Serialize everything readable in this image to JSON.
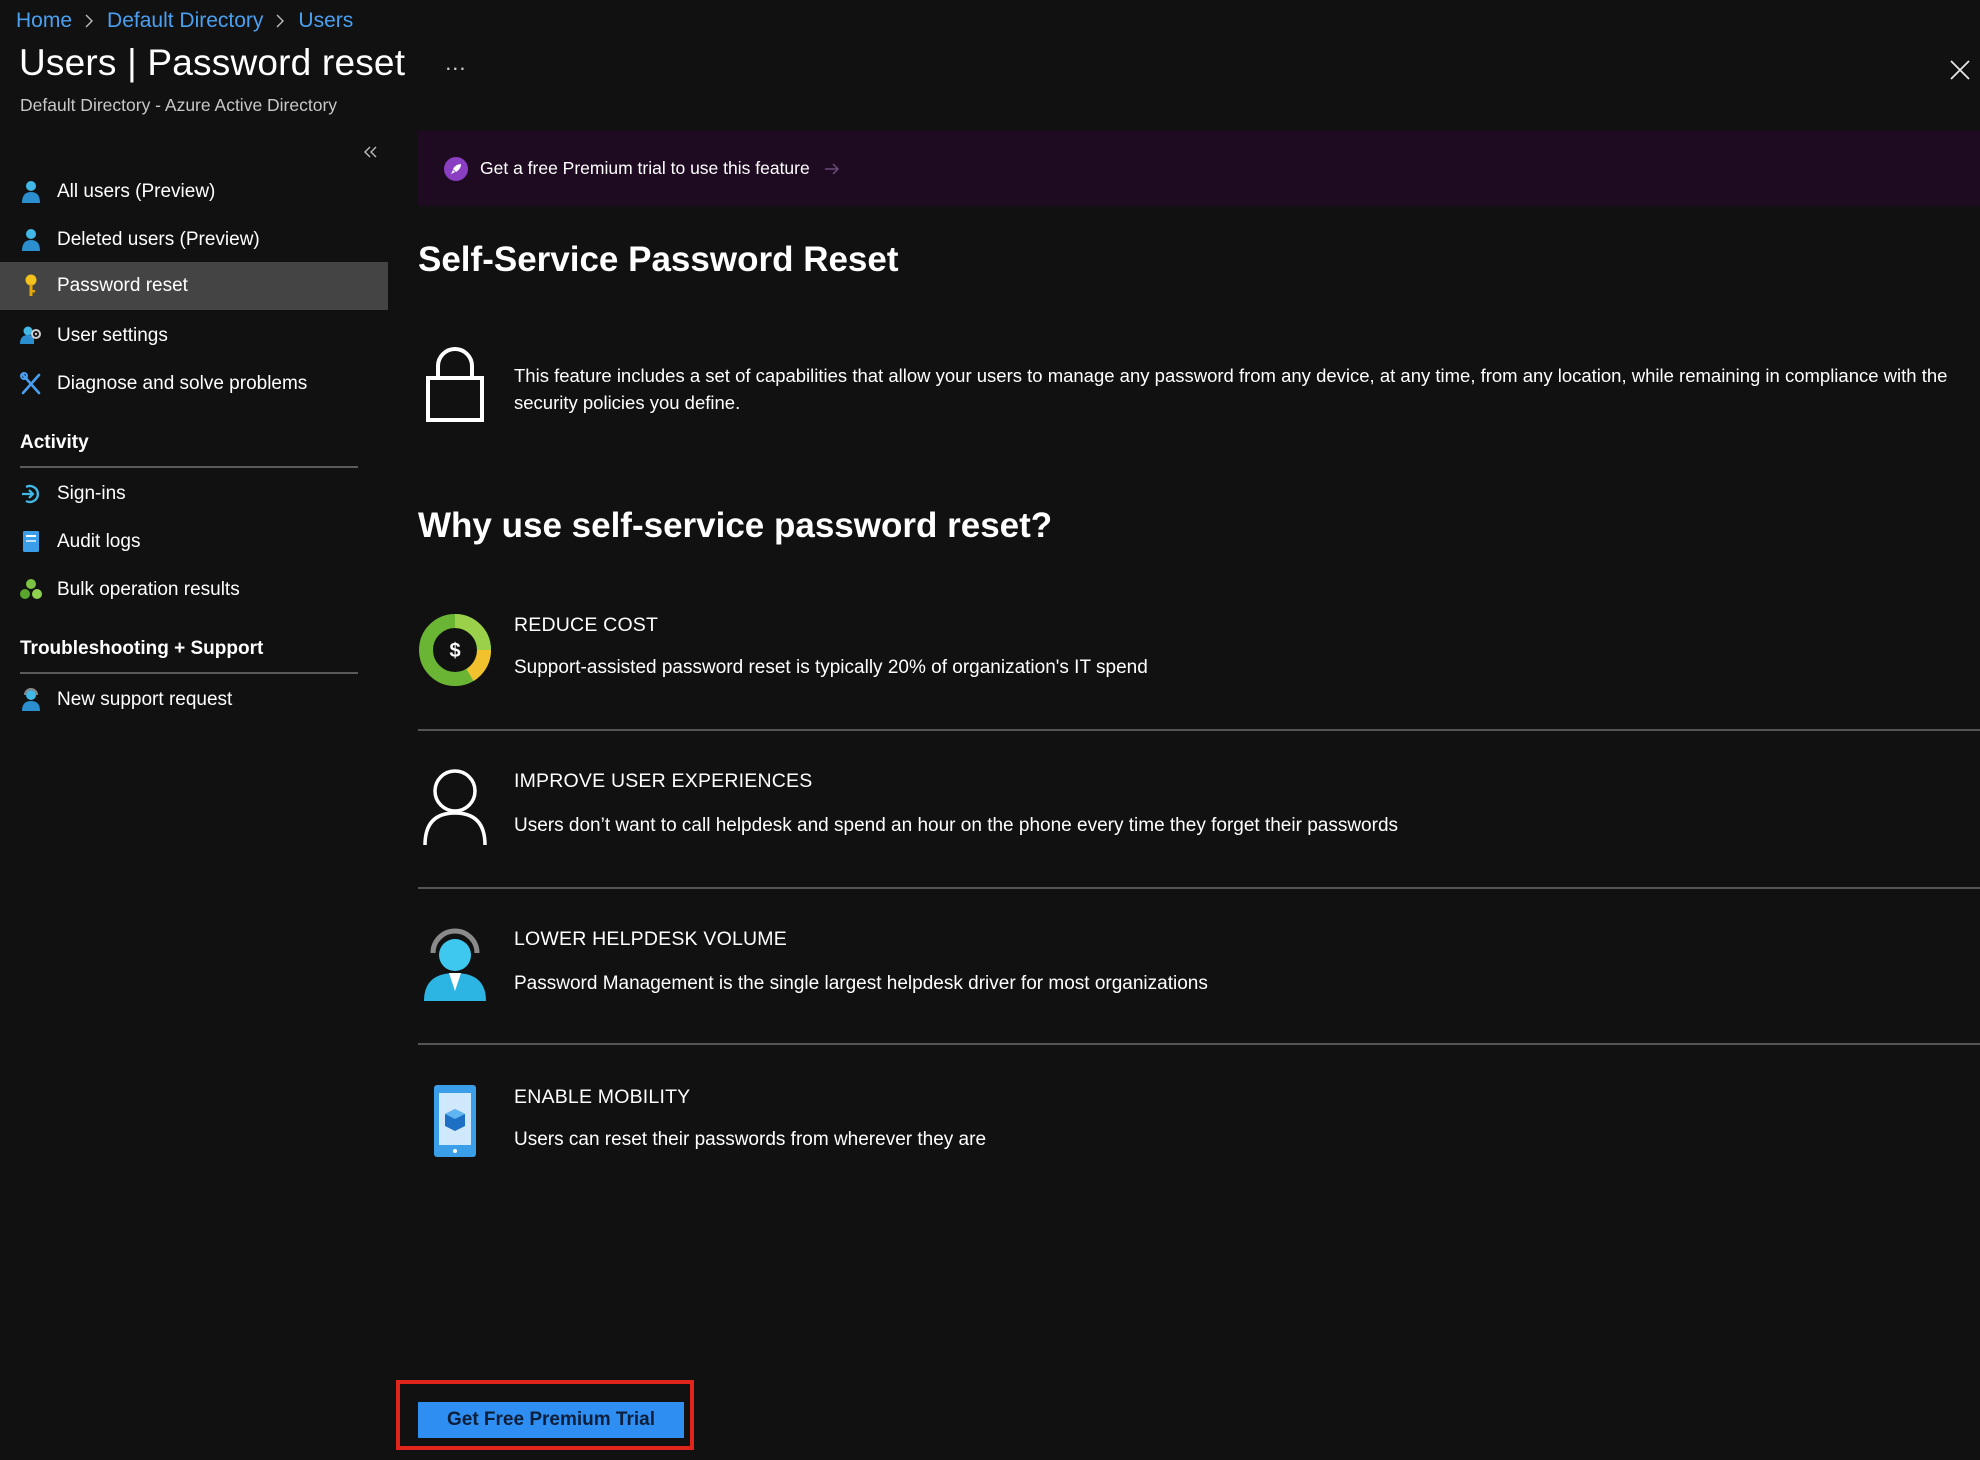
{
  "breadcrumb": {
    "items": [
      "Home",
      "Default Directory",
      "Users"
    ]
  },
  "header": {
    "title": "Users | Password reset",
    "more": "...",
    "subtitle": "Default Directory - Azure Active Directory"
  },
  "sidebar": {
    "items": [
      {
        "label": "All users (Preview)",
        "icon": "user-icon"
      },
      {
        "label": "Deleted users (Preview)",
        "icon": "user-icon"
      },
      {
        "label": "Password reset",
        "icon": "key-icon",
        "selected": true
      },
      {
        "label": "User settings",
        "icon": "user-settings-icon"
      },
      {
        "label": "Diagnose and solve problems",
        "icon": "wrench-icon"
      }
    ],
    "activity": {
      "title": "Activity",
      "items": [
        {
          "label": "Sign-ins",
          "icon": "sign-in-icon"
        },
        {
          "label": "Audit logs",
          "icon": "audit-log-icon"
        },
        {
          "label": "Bulk operation results",
          "icon": "bulk-operations-icon"
        }
      ]
    },
    "support": {
      "title": "Troubleshooting + Support",
      "items": [
        {
          "label": "New support request",
          "icon": "support-user-icon"
        }
      ]
    }
  },
  "banner": {
    "text": "Get a free Premium trial to use this feature",
    "icon": "rocket-icon"
  },
  "main": {
    "heading": "Self-Service Password Reset",
    "intro": "This feature includes a set of capabilities that allow your users to manage any password from any device, at any time, from any location, while remaining in compliance with the security policies you define.",
    "why_heading": "Why use self-service password reset?",
    "benefits": [
      {
        "title": "REDUCE COST",
        "desc": "Support-assisted password reset is typically 20% of organization's IT spend",
        "icon": "cost-donut-icon"
      },
      {
        "title": "IMPROVE USER EXPERIENCES",
        "desc": "Users don’t want to call helpdesk and spend an hour on the phone every time they forget their passwords",
        "icon": "user-outline-icon"
      },
      {
        "title": "LOWER HELPDESK VOLUME",
        "desc": "Password Management is the single largest helpdesk driver for most organizations",
        "icon": "headset-agent-icon"
      },
      {
        "title": "ENABLE MOBILITY",
        "desc": "Users can reset their passwords from wherever they are",
        "icon": "mobile-device-icon"
      }
    ]
  },
  "cta": {
    "label": "Get Free Premium Trial"
  },
  "colors": {
    "background": "#111111",
    "link": "#4aa0f0",
    "selected_nav": "#444444",
    "banner_bg": "#1e0b22",
    "primary_button": "#2f8ef2",
    "highlight_outline": "#e0261b"
  }
}
